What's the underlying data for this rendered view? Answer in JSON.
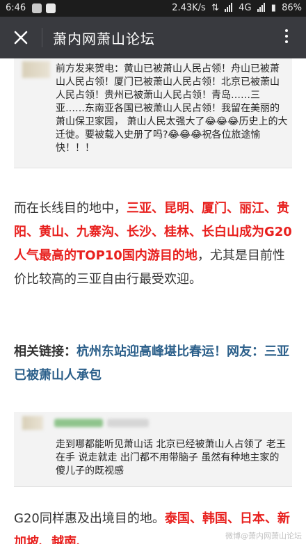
{
  "status_bar": {
    "time": "6:46",
    "speed": "2.43K/s",
    "network": "4G",
    "battery": "86%"
  },
  "app_bar": {
    "title": "萧内网萧山论坛"
  },
  "article": {
    "quote1": {
      "text": "前方发来贺电：黄山已被萧山人民占领！舟山已被萧山人民占领！厦门已被萧山人民占领！北京已被萧山人民占领！贵州已被萧山人民占领！青岛……三亚……东南亚各国已被萧山人民占领！我留在美丽的萧山保卫家园，    萧山人民太强大了😂😂😂历史上的大迁徙。要被载入史册了吗?😂😂😂祝各位旅途愉快！！！"
    },
    "para1": {
      "prefix": "而在长线目的地中，",
      "highlight": "三亚、昆明、厦门、丽江、贵阳、黄山、九寨沟、长沙、桂林、长白山成为G20人气最高的TOP10国内游目的地",
      "suffix": "，尤其是目前性价比较高的三亚自由行最受欢迎。"
    },
    "related": {
      "label": "相关链接：",
      "link": "杭州东站迎高峰堪比春运！网友：三亚已被萧山人承包"
    },
    "quote2": {
      "text": "走到哪都能听见萧山话 北京已经被萧山人占领了 老王在手 说走就走 出门都不用带脑子 虽然有种地主家的傻儿子的既视感"
    },
    "para2": {
      "prefix": "G20同样惠及出境目的地。",
      "highlight": "泰国、韩国、日本、新加坡、越南、"
    }
  },
  "watermark": "微博@萧内网萧山论坛"
}
